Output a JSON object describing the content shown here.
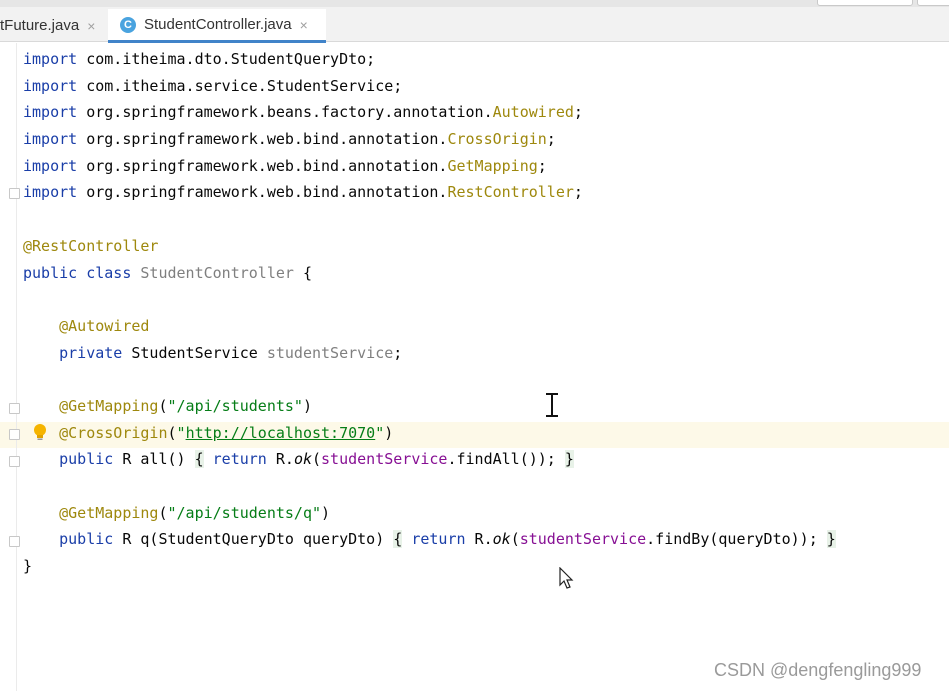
{
  "tabs": [
    {
      "label": "tFuture.java",
      "close": "×",
      "active": false
    },
    {
      "label": "StudentController.java",
      "close": "×",
      "active": true,
      "icon": "C"
    }
  ],
  "code": {
    "l1": [
      "import",
      " com.itheima.dto.StudentQueryDto;"
    ],
    "l2": [
      "import",
      " com.itheima.service.StudentService;"
    ],
    "l3": [
      "import",
      " org.springframework.beans.factory.annotation.",
      "Autowired",
      ";"
    ],
    "l4": [
      "import",
      " org.springframework.web.bind.annotation.",
      "CrossOrigin",
      ";"
    ],
    "l5": [
      "import",
      " org.springframework.web.bind.annotation.",
      "GetMapping",
      ";"
    ],
    "l6": [
      "import",
      " org.springframework.web.bind.annotation.",
      "RestController",
      ";"
    ],
    "l8": [
      "@RestController"
    ],
    "l9": [
      "public class",
      " ",
      "StudentController",
      " {"
    ],
    "l11": [
      "    ",
      "@Autowired"
    ],
    "l12": [
      "    ",
      "private",
      " StudentService ",
      "studentService",
      ";"
    ],
    "l14": [
      "    ",
      "@GetMapping",
      "(",
      "\"/api/students\"",
      ")"
    ],
    "l15": [
      "    ",
      "@CrossOrigin",
      "(",
      "\"",
      "http://localhost:7070",
      "\"",
      ")"
    ],
    "l16": [
      "    ",
      "public",
      " R all() ",
      "{",
      " ",
      "return",
      " R.",
      "ok",
      "(",
      "studentService",
      ".findAll()); ",
      "}"
    ],
    "l18": [
      "    ",
      "@GetMapping",
      "(",
      "\"/api/students/q\"",
      ")"
    ],
    "l19": [
      "    ",
      "public",
      " R q(StudentQueryDto queryDto) ",
      "{",
      " ",
      "return",
      " R.",
      "ok",
      "(",
      "studentService",
      ".findBy(queryDto)); ",
      "}"
    ],
    "l20": [
      "}"
    ]
  },
  "watermark": "CSDN @dengfengling999",
  "colors": {
    "keyword": "#1a3ea8",
    "annotation": "#9e880d",
    "field": "#871094",
    "string": "#067d17",
    "tab_accent": "#4083c9"
  },
  "icons": [
    "class-icon",
    "bulb-icon",
    "fold-marker-icon",
    "text-cursor-icon",
    "mouse-pointer-icon"
  ]
}
